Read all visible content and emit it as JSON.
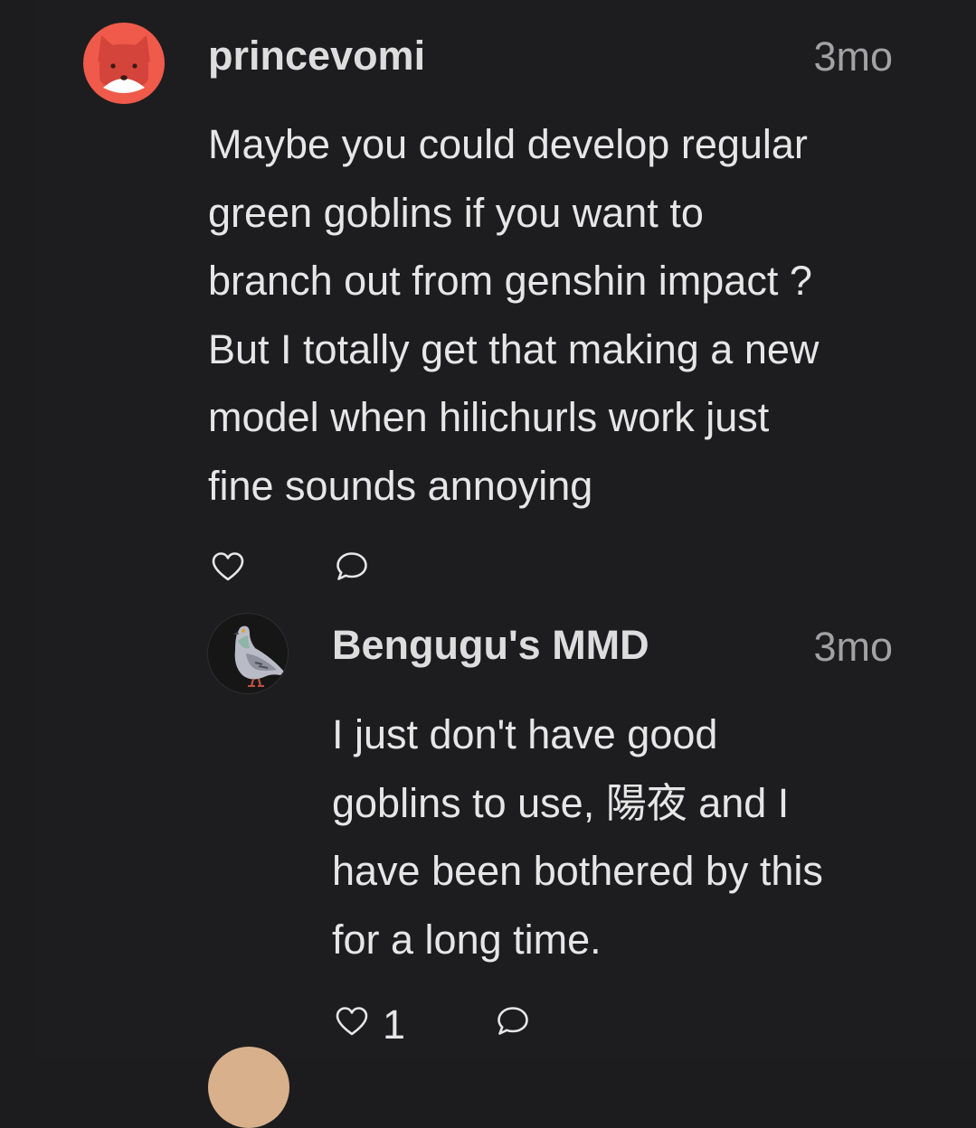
{
  "comments": [
    {
      "username": "princevomi",
      "time": "3mo",
      "avatar_icon": "fox-avatar-icon",
      "avatar_color": "#ef5a4b",
      "lines": [
        "Maybe you could develop regular",
        "green goblins if you want to",
        "branch out from genshin impact ?",
        "But I totally get that making a new",
        "model when hilichurls work just",
        "fine sounds annoying"
      ],
      "actions": {
        "like_icon": "heart-icon",
        "reply_icon": "speech-bubble-icon"
      }
    }
  ],
  "reply": {
    "username": "Bengugu's MMD",
    "time": "3mo",
    "avatar_icon": "pigeon-avatar-icon",
    "lines": [
      "I just don't have good",
      "goblins to use, 陽夜 and I",
      "have been bothered by this",
      "for a long time."
    ],
    "actions": {
      "like_icon": "heart-icon",
      "like_count": "1",
      "reply_icon": "speech-bubble-icon"
    }
  }
}
